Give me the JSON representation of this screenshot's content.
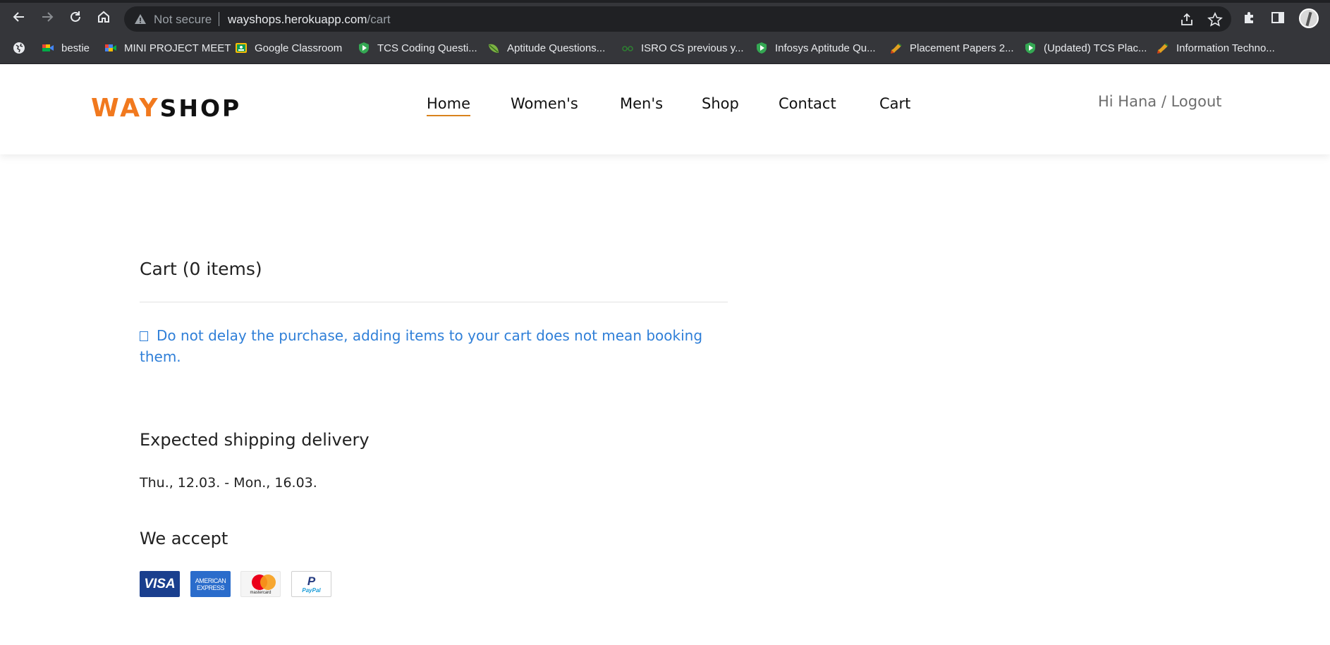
{
  "browser": {
    "not_secure_label": "Not secure",
    "url_host": "wayshops.herokuapp.com",
    "url_path": "/cart",
    "icons": {
      "back": "back-arrow-icon",
      "forward": "forward-arrow-icon",
      "reload": "reload-icon",
      "home": "home-icon",
      "warning": "warning-triangle-icon",
      "share": "share-icon",
      "star": "star-icon",
      "extensions": "puzzle-icon",
      "side_panel": "side-panel-icon",
      "profile": "profile-avatar"
    },
    "bookmarks": [
      {
        "label": "",
        "icon": "globe-icon",
        "color": "#e8eaed"
      },
      {
        "label": "bestie",
        "icon": "meet-icon",
        "color": "#34a853"
      },
      {
        "label": "MINI PROJECT MEET",
        "icon": "meet-icon",
        "color": "#4285f4"
      },
      {
        "label": "Google Classroom",
        "icon": "classroom-icon",
        "color": "#fbbc04"
      },
      {
        "label": "TCS Coding Questi...",
        "icon": "shield-icon",
        "color": "#34a853"
      },
      {
        "label": "Aptitude Questions...",
        "icon": "leaf-icon",
        "color": "#7cb342"
      },
      {
        "label": "ISRO CS previous y...",
        "icon": "glasses-icon",
        "color": "#2e7d32"
      },
      {
        "label": "Infosys Aptitude Qu...",
        "icon": "shield-icon",
        "color": "#34a853"
      },
      {
        "label": "Placement Papers 2...",
        "icon": "brush-icon",
        "color": "#e0a020"
      },
      {
        "label": "(Updated) TCS Plac...",
        "icon": "shield-icon",
        "color": "#34a853"
      },
      {
        "label": "Information Techno...",
        "icon": "brush-icon",
        "color": "#e0a020"
      }
    ]
  },
  "header": {
    "logo_way": "WAY",
    "logo_shop": "SHOP",
    "nav": [
      {
        "label": "Home",
        "active": true
      },
      {
        "label": "Women's",
        "active": false
      },
      {
        "label": "Men's",
        "active": false
      },
      {
        "label": "Shop",
        "active": false
      },
      {
        "label": "Contact",
        "active": false
      },
      {
        "label": "Cart",
        "active": false
      }
    ],
    "greeting": "Hi Hana",
    "separator": "/",
    "logout": "Logout"
  },
  "cart": {
    "title": "Cart (0 items)",
    "notice": "Do not delay the purchase, adding items to your cart does not mean booking them.",
    "shipping_heading": "Expected shipping delivery",
    "shipping_dates": "Thu., 12.03. - Mon., 16.03.",
    "accept_heading": "We accept",
    "payment_methods": [
      {
        "name": "VISA",
        "icon": "visa-card-icon"
      },
      {
        "name": "AMERICAN EXPRESS",
        "icon": "amex-card-icon"
      },
      {
        "name": "mastercard",
        "icon": "mastercard-icon"
      },
      {
        "name": "PayPal",
        "icon": "paypal-icon"
      }
    ]
  },
  "colors": {
    "brand_orange": "#f1791e",
    "notice_blue": "#2f7fd8",
    "chrome_dark": "#35363a"
  }
}
